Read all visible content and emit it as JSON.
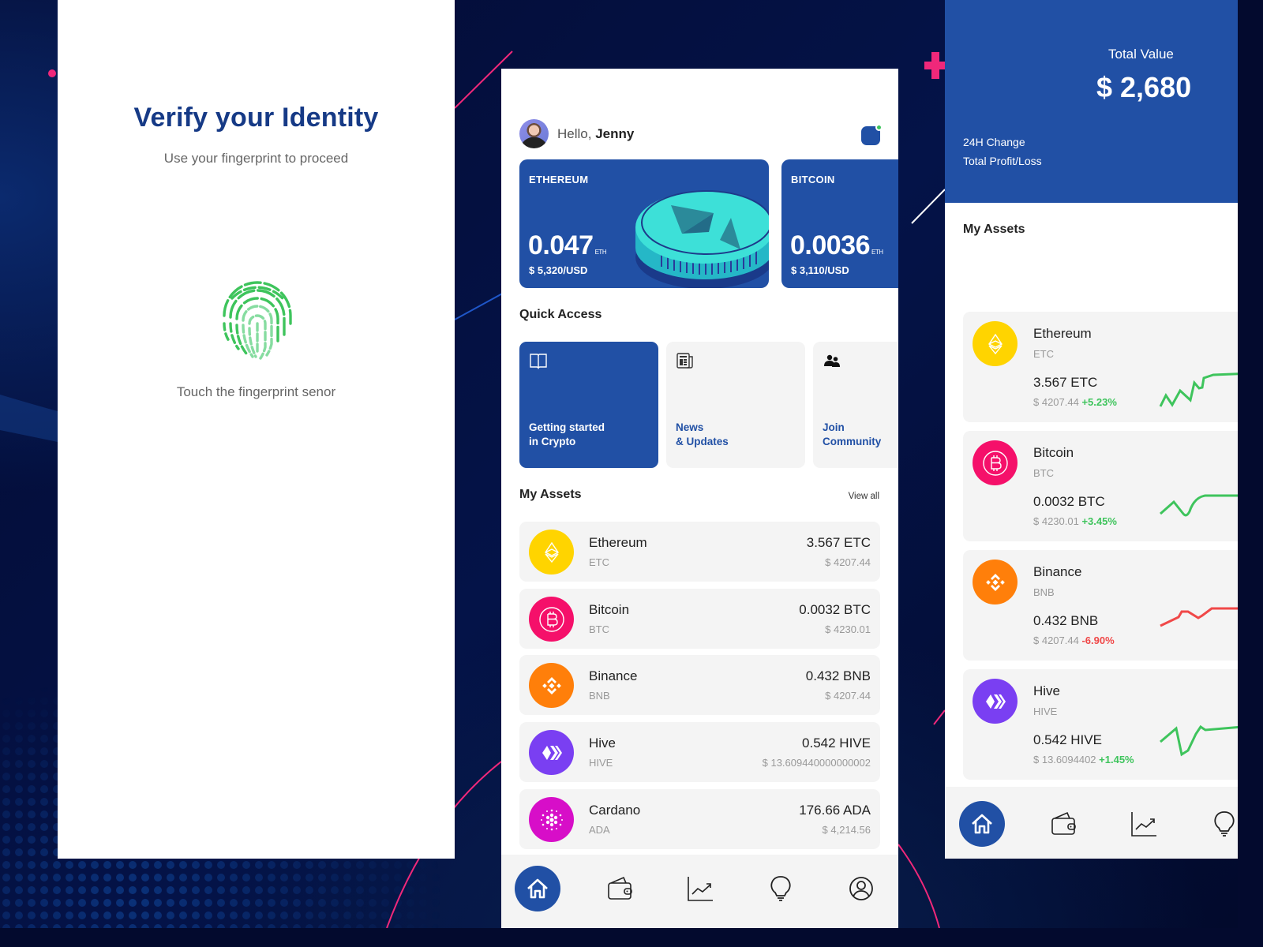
{
  "verify": {
    "title": "Verify your Identity",
    "subtitle": "Use your fingerprint to proceed",
    "hint": "Touch the fingerprint senor",
    "fingerprint_color": "#3ec45c"
  },
  "home": {
    "greeting_prefix": "Hello, ",
    "user_name": "Jenny",
    "notification_badge": "green-dot",
    "coin_cards": [
      {
        "label": "ETHEREUM",
        "amount": "0.047",
        "unit": "ETH",
        "usd": "$ 5,320/USD"
      },
      {
        "label": "BITCOIN",
        "amount": "0.0036",
        "unit": "ETH",
        "usd": "$ 3,110/USD"
      }
    ],
    "quick_access_title": "Quick Access",
    "quick_access": [
      {
        "line1": "Getting started",
        "line2": "in Crypto",
        "icon": "book-icon",
        "active": true
      },
      {
        "line1": "News",
        "line2": "& Updates",
        "icon": "newspaper-icon",
        "active": false
      },
      {
        "line1": "Join",
        "line2": "Community",
        "icon": "community-icon",
        "active": false
      }
    ],
    "assets_title": "My Assets",
    "view_all": "View all",
    "assets": [
      {
        "name": "Ethereum",
        "symbol": "ETC",
        "amount": "3.567 ETC",
        "usd": "$ 4207.44",
        "color": "#ffd400",
        "icon": "ethereum-icon"
      },
      {
        "name": "Bitcoin",
        "symbol": "BTC",
        "amount": "0.0032 BTC",
        "usd": "$ 4230.01",
        "color": "#f5106a",
        "icon": "bitcoin-icon"
      },
      {
        "name": "Binance",
        "symbol": "BNB",
        "amount": "0.432 BNB",
        "usd": "$ 4207.44",
        "color": "#ff7f0a",
        "icon": "binance-icon"
      },
      {
        "name": "Hive",
        "symbol": "HIVE",
        "amount": "0.542 HIVE",
        "usd": "$ 13.609440000000002",
        "color": "#7a3ff2",
        "icon": "hive-icon"
      },
      {
        "name": "Cardano",
        "symbol": "ADA",
        "amount": "176.66 ADA",
        "usd": "$ 4,214.56",
        "color": "#d70ec8",
        "icon": "cardano-icon"
      }
    ],
    "nav": [
      "home",
      "wallet",
      "chart",
      "ideas",
      "profile"
    ],
    "nav_active": "home"
  },
  "portfolio": {
    "total_value_label": "Total Value",
    "total_value": "$ 2,680",
    "change_label": "24H Change",
    "profit_label": "Total Profit/Loss",
    "assets_title": "My Assets",
    "assets": [
      {
        "name": "Ethereum",
        "symbol": "ETC",
        "amount": "3.567 ETC",
        "usd": "$ 4207.44",
        "change": "+5.23%",
        "trend": "up",
        "color": "#ffd400"
      },
      {
        "name": "Bitcoin",
        "symbol": "BTC",
        "amount": "0.0032 BTC",
        "usd": "$ 4230.01",
        "change": "+3.45%",
        "trend": "up",
        "color": "#f5106a"
      },
      {
        "name": "Binance",
        "symbol": "BNB",
        "amount": "0.432 BNB",
        "usd": "$ 4207.44",
        "change": "-6.90%",
        "trend": "down",
        "color": "#ff7f0a"
      },
      {
        "name": "Hive",
        "symbol": "HIVE",
        "amount": "0.542 HIVE",
        "usd": "$ 13.6094402",
        "change": "+1.45%",
        "trend": "up",
        "color": "#7a3ff2"
      }
    ],
    "nav_active": "home"
  },
  "colors": {
    "brand": "#2150a5",
    "title_navy": "#163a86",
    "positive": "#3ec45c",
    "negative": "#f04848",
    "card_bg": "#f4f4f4"
  }
}
